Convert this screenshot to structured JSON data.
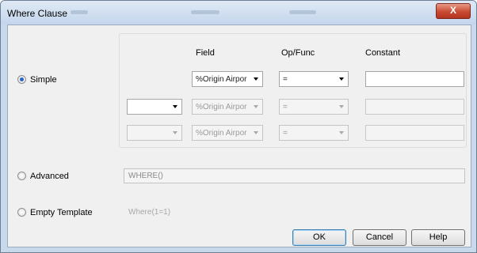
{
  "window": {
    "title": "Where Clause",
    "close_label": "X"
  },
  "columns": {
    "field": "Field",
    "op": "Op/Func",
    "constant": "Constant"
  },
  "options": {
    "simple": "Simple",
    "advanced": "Advanced",
    "empty_template": "Empty Template",
    "selected": "simple"
  },
  "rows": [
    {
      "connector": "",
      "field": "%Origin Airpor",
      "op": "=",
      "constant": "",
      "enabled": true
    },
    {
      "connector": "",
      "field": "%Origin Airpor",
      "op": "=",
      "constant": "",
      "enabled": false
    },
    {
      "connector": "",
      "field": "%Origin Airpor",
      "op": "=",
      "constant": "",
      "enabled": false
    }
  ],
  "advanced_text": "WHERE()",
  "empty_template_text": "Where(1=1)",
  "buttons": {
    "ok": "OK",
    "cancel": "Cancel",
    "help": "Help"
  }
}
